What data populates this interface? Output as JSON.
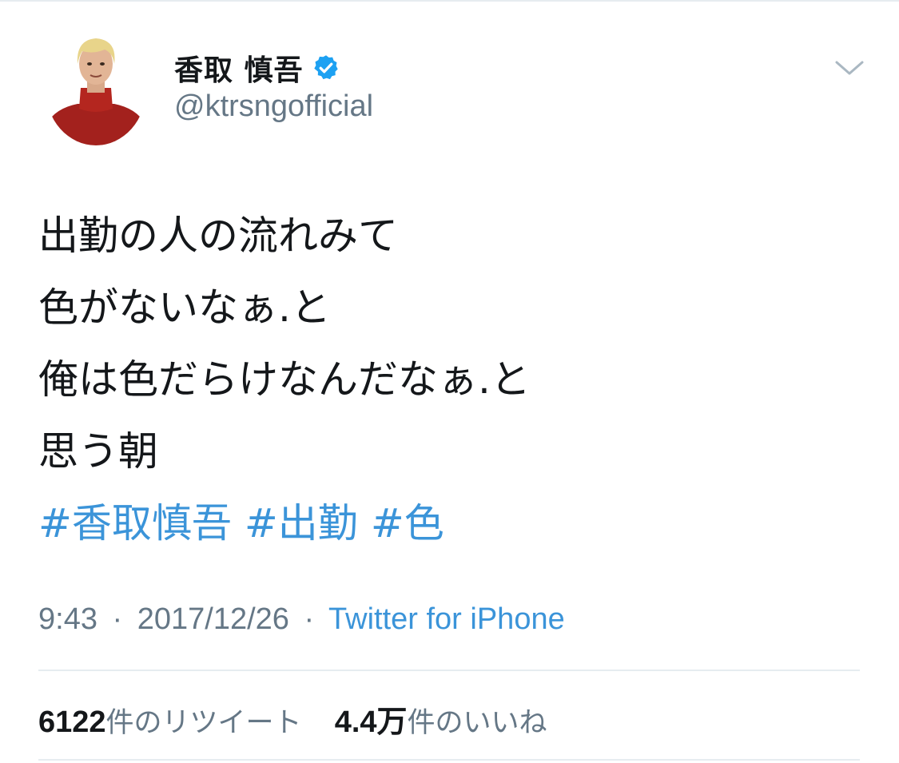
{
  "header": {
    "display_name": "香取 慎吾",
    "handle": "@ktrsngofficial",
    "avatar_icon": "avatar-photo",
    "verified_icon": "verified-badge-icon",
    "menu_icon": "chevron-down-icon"
  },
  "body": {
    "lines": [
      "出勤の人の流れみて",
      "色がないなぁ.と",
      "俺は色だらけなんだなぁ.と",
      "思う朝"
    ],
    "hashtags": [
      "#香取慎吾",
      "#出勤",
      "#色"
    ]
  },
  "meta": {
    "time": "9:43",
    "separator": "·",
    "date": "2017/12/26",
    "source": "Twitter for iPhone"
  },
  "stats": {
    "retweets_count": "6122",
    "retweets_label": "件のリツイート",
    "likes_count": "4.4万",
    "likes_label": "件のいいね"
  },
  "colors": {
    "link": "#3b94d9",
    "secondary_text": "#657786",
    "primary_text": "#14171a",
    "verified": "#1da1f2",
    "divider": "#e6ecf0"
  }
}
